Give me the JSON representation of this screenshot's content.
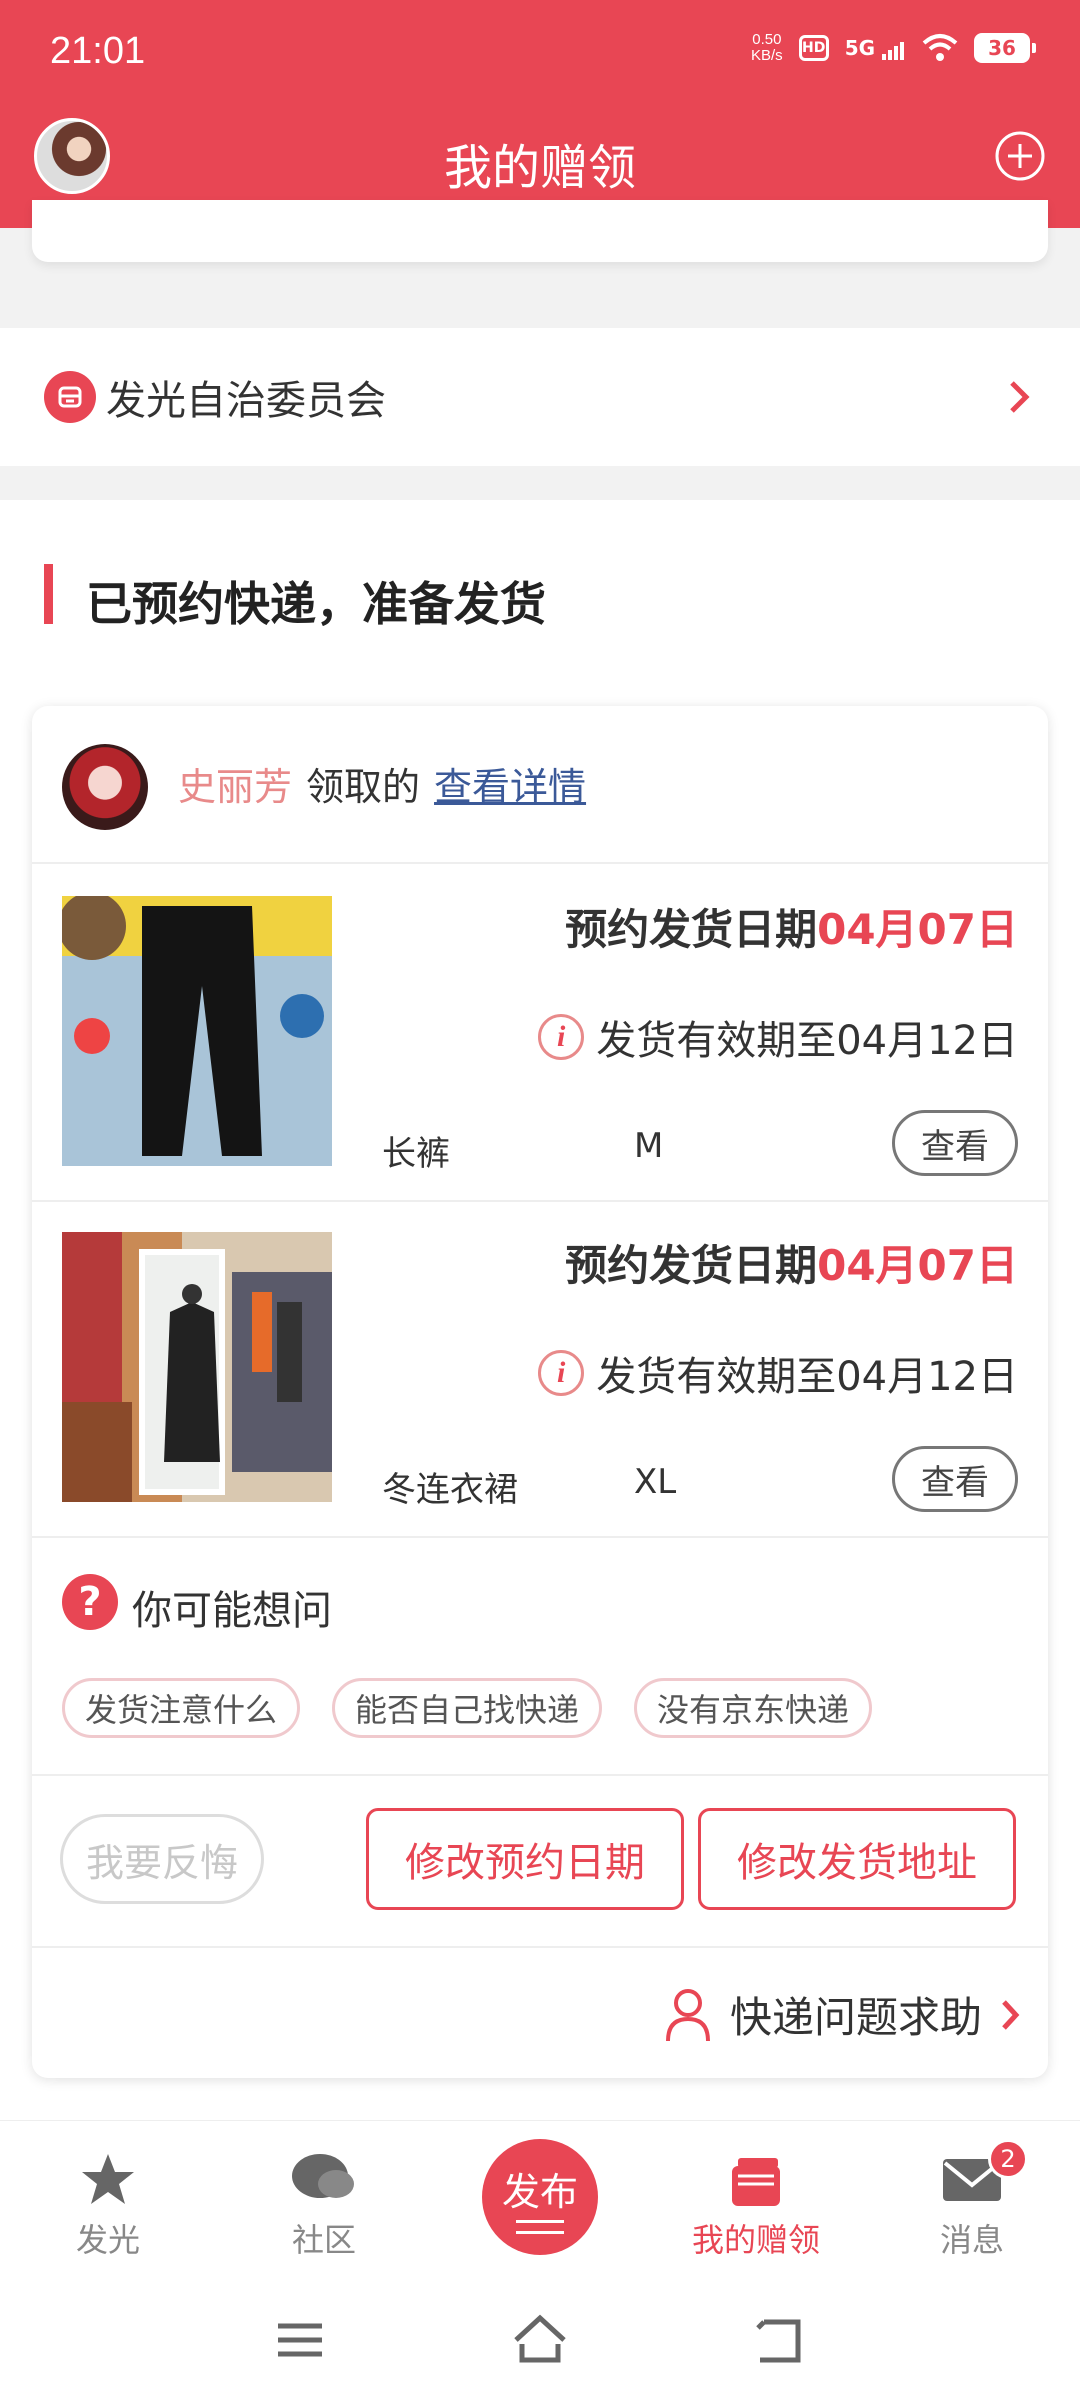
{
  "status_bar": {
    "time": "21:01",
    "net_speed_value": "0.50",
    "net_speed_unit": "KB/s",
    "hd": "HD",
    "network": "5G",
    "battery": "36"
  },
  "header": {
    "title": "我的赠领"
  },
  "committee": {
    "label": "发光自治委员会"
  },
  "section": {
    "title": "已预约快递，准备发货"
  },
  "order": {
    "giver_name": "史丽芳",
    "giver_action": "领取的",
    "view_detail": "查看详情",
    "items": [
      {
        "ship_label": "预约发货日期",
        "ship_date": "04月07日",
        "validity": "发货有效期至04月12日",
        "name": "长裤",
        "size": "M",
        "view_label": "查看"
      },
      {
        "ship_label": "预约发货日期",
        "ship_date": "04月07日",
        "validity": "发货有效期至04月12日",
        "name": "冬连衣裙",
        "size": "XL",
        "view_label": "查看"
      }
    ],
    "faq_title": "你可能想问",
    "faq_chips": [
      "发货注意什么",
      "能否自己找快递",
      "没有京东快递"
    ],
    "regret_label": "我要反悔",
    "change_date_label": "修改预约日期",
    "change_address_label": "修改发货地址",
    "help_label": "快递问题求助"
  },
  "bottom_nav": {
    "items": [
      {
        "label": "发光",
        "icon": "star-icon"
      },
      {
        "label": "社区",
        "icon": "chat-icon"
      },
      {
        "label": "发布",
        "icon": "publish-icon"
      },
      {
        "label": "我的赠领",
        "icon": "gift-box-icon"
      },
      {
        "label": "消息",
        "icon": "mail-icon",
        "badge": "2"
      }
    ]
  },
  "colors": {
    "accent": "#e84654",
    "link": "#3b5998"
  }
}
